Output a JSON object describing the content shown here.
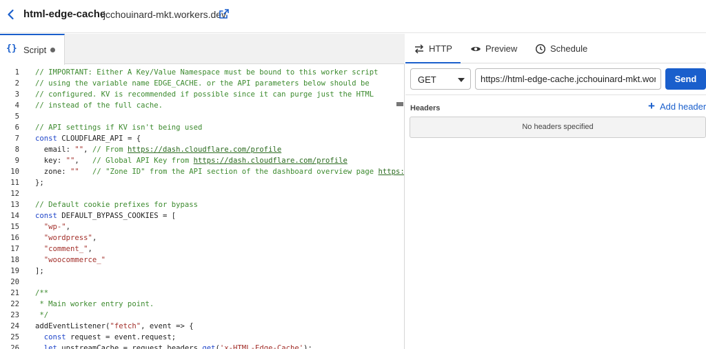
{
  "header": {
    "worker_name": "html-edge-cache",
    "worker_domain": ".jcchouinard-mkt.workers.dev"
  },
  "editor": {
    "tab_label": "Script",
    "tab_icon": "{}",
    "lines": [
      {
        "n": "1",
        "parts": [
          {
            "t": "// IMPORTANT: Either A Key/Value Namespace must be bound to this worker script",
            "c": "c"
          }
        ]
      },
      {
        "n": "2",
        "parts": [
          {
            "t": "// using the variable name EDGE_CACHE. or the API parameters below should be",
            "c": "c"
          }
        ]
      },
      {
        "n": "3",
        "parts": [
          {
            "t": "// configured. KV is recommended if possible since it can purge just the HTML",
            "c": "c"
          }
        ]
      },
      {
        "n": "4",
        "parts": [
          {
            "t": "// instead of the full cache.",
            "c": "c"
          }
        ]
      },
      {
        "n": "5",
        "parts": []
      },
      {
        "n": "6",
        "parts": [
          {
            "t": "// API settings if KV isn't being used",
            "c": "c"
          }
        ]
      },
      {
        "n": "7",
        "parts": [
          {
            "t": "const",
            "c": "k"
          },
          {
            "t": " CLOUDFLARE_API = {",
            "c": "p"
          }
        ]
      },
      {
        "n": "8",
        "parts": [
          {
            "t": "  email: ",
            "c": "p"
          },
          {
            "t": "\"\"",
            "c": "s"
          },
          {
            "t": ", ",
            "c": "p"
          },
          {
            "t": "// From ",
            "c": "c"
          },
          {
            "t": "https://dash.cloudflare.com/profile",
            "c": "u"
          }
        ]
      },
      {
        "n": "9",
        "parts": [
          {
            "t": "  key: ",
            "c": "p"
          },
          {
            "t": "\"\"",
            "c": "s"
          },
          {
            "t": ",   ",
            "c": "p"
          },
          {
            "t": "// Global API Key from ",
            "c": "c"
          },
          {
            "t": "https://dash.cloudflare.com/profile",
            "c": "u"
          }
        ]
      },
      {
        "n": "10",
        "parts": [
          {
            "t": "  zone: ",
            "c": "p"
          },
          {
            "t": "\"\"",
            "c": "s"
          },
          {
            "t": "   ",
            "c": "p"
          },
          {
            "t": "// \"Zone ID\" from the API section of the dashboard overview page ",
            "c": "c"
          },
          {
            "t": "https:/",
            "c": "u"
          }
        ]
      },
      {
        "n": "11",
        "parts": [
          {
            "t": "};",
            "c": "p"
          }
        ]
      },
      {
        "n": "12",
        "parts": []
      },
      {
        "n": "13",
        "parts": [
          {
            "t": "// Default cookie prefixes for bypass",
            "c": "c"
          }
        ]
      },
      {
        "n": "14",
        "parts": [
          {
            "t": "const",
            "c": "k"
          },
          {
            "t": " DEFAULT_BYPASS_COOKIES = [",
            "c": "p"
          }
        ]
      },
      {
        "n": "15",
        "parts": [
          {
            "t": "  ",
            "c": "p"
          },
          {
            "t": "\"wp-\"",
            "c": "s"
          },
          {
            "t": ",",
            "c": "p"
          }
        ]
      },
      {
        "n": "16",
        "parts": [
          {
            "t": "  ",
            "c": "p"
          },
          {
            "t": "\"wordpress\"",
            "c": "s"
          },
          {
            "t": ",",
            "c": "p"
          }
        ]
      },
      {
        "n": "17",
        "parts": [
          {
            "t": "  ",
            "c": "p"
          },
          {
            "t": "\"comment_\"",
            "c": "s"
          },
          {
            "t": ",",
            "c": "p"
          }
        ]
      },
      {
        "n": "18",
        "parts": [
          {
            "t": "  ",
            "c": "p"
          },
          {
            "t": "\"woocommerce_\"",
            "c": "s"
          }
        ]
      },
      {
        "n": "19",
        "parts": [
          {
            "t": "];",
            "c": "p"
          }
        ]
      },
      {
        "n": "20",
        "parts": []
      },
      {
        "n": "21",
        "parts": [
          {
            "t": "/**",
            "c": "c"
          }
        ]
      },
      {
        "n": "22",
        "parts": [
          {
            "t": " * Main worker entry point.",
            "c": "c"
          }
        ]
      },
      {
        "n": "23",
        "parts": [
          {
            "t": " */",
            "c": "c"
          }
        ]
      },
      {
        "n": "24",
        "parts": [
          {
            "t": "addEventListener(",
            "c": "p"
          },
          {
            "t": "\"fetch\"",
            "c": "s"
          },
          {
            "t": ", event => {",
            "c": "p"
          }
        ]
      },
      {
        "n": "25",
        "parts": [
          {
            "t": "  ",
            "c": "p"
          },
          {
            "t": "const",
            "c": "k"
          },
          {
            "t": " request = event.request;",
            "c": "p"
          }
        ]
      },
      {
        "n": "26",
        "parts": [
          {
            "t": "  ",
            "c": "p"
          },
          {
            "t": "let",
            "c": "k"
          },
          {
            "t": " upstreamCache = request.headers.",
            "c": "p"
          },
          {
            "t": "get",
            "c": "k"
          },
          {
            "t": "(",
            "c": "p"
          },
          {
            "t": "'x-HTML-Edge-Cache'",
            "c": "s"
          },
          {
            "t": ");",
            "c": "p"
          }
        ]
      }
    ]
  },
  "panel": {
    "tabs": [
      {
        "label": "HTTP",
        "icon": "arrows-icon",
        "active": true
      },
      {
        "label": "Preview",
        "icon": "eye-icon",
        "active": false
      },
      {
        "label": "Schedule",
        "icon": "clock-icon",
        "active": false
      }
    ],
    "method": "GET",
    "url": "https://html-edge-cache.jcchouinard-mkt.workers.dev",
    "send_label": "Send",
    "headers_title": "Headers",
    "add_header_label": "Add header",
    "no_headers_text": "No headers specified"
  },
  "colors": {
    "accent": "#1a5fcc",
    "comment": "#3c8a2e",
    "keyword": "#1f45c9",
    "string": "#a3302b"
  }
}
